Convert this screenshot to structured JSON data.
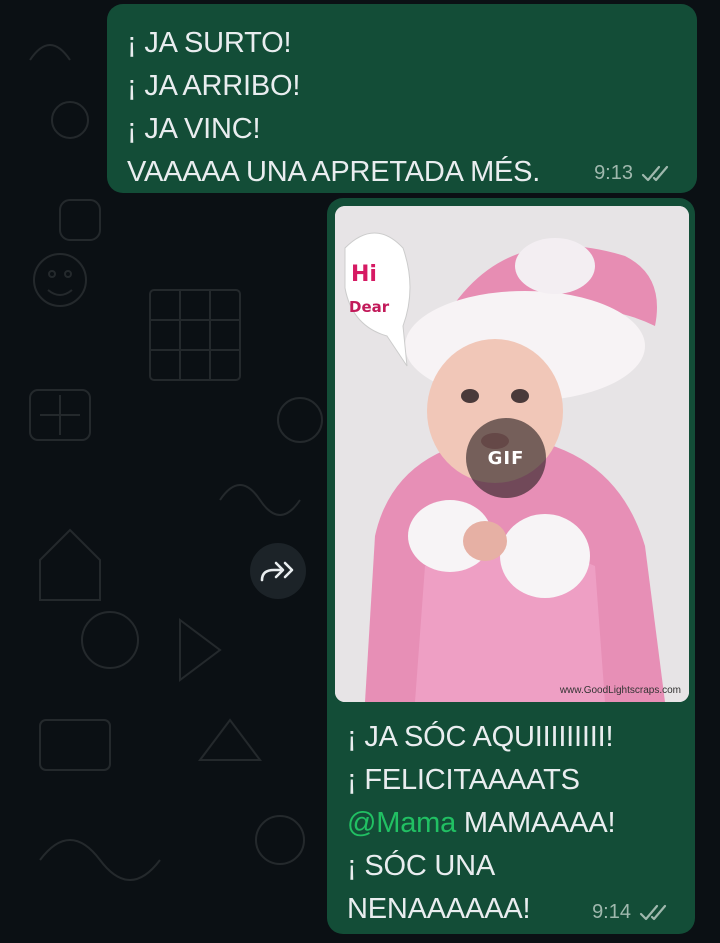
{
  "colors": {
    "background": "#0b1014",
    "bubble_outgoing": "#134d37",
    "text": "#e9edef",
    "mention": "#21c063",
    "meta": "#9fb8ad"
  },
  "messages": [
    {
      "lines": [
        "¡ JA SURTO!",
        "¡ JA ARRIBO!",
        "¡ JA VINC!",
        "VAAAAA UNA APRETADA MÉS."
      ],
      "time": "9:13",
      "status_icon": "double-check-icon"
    },
    {
      "media": {
        "badge": "GIF",
        "speech_line1": "Hi",
        "speech_line2": "Dear",
        "watermark": "www.GoodLightscraps.com"
      },
      "line1": "¡ JA SÓC AQUIIIIIIIII!",
      "line2": "¡ FELICITAAAATS",
      "mention": "@Mama",
      "line3_rest": " MAMAAAA!",
      "line4": "¡ SÓC UNA",
      "line5": "NENAAAAAA!",
      "time": "9:14",
      "status_icon": "double-check-icon"
    }
  ],
  "forward_icon": "forward-icon"
}
